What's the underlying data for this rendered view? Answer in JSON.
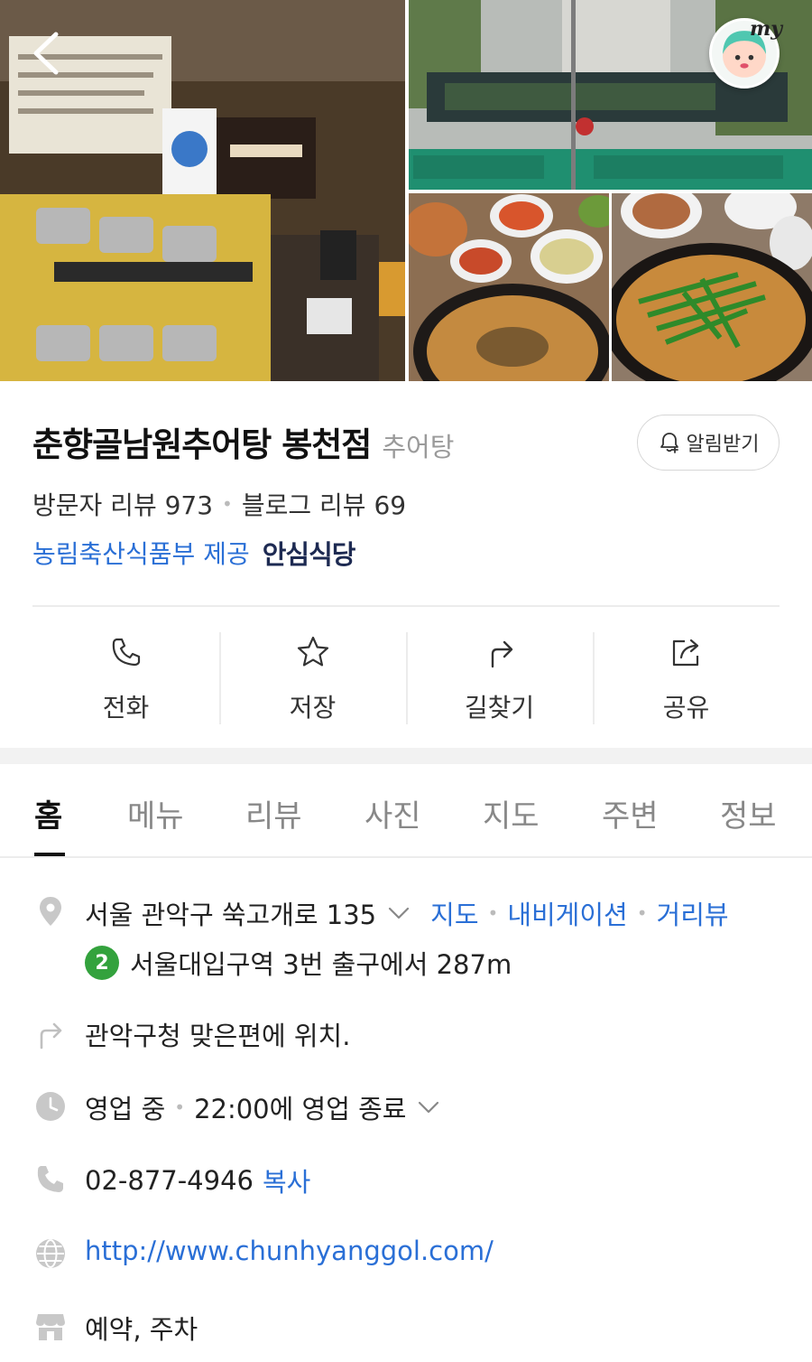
{
  "header": {
    "my_label": "my",
    "icons": {
      "back": "chevron-left-icon",
      "profile": "avatar-icon"
    }
  },
  "place": {
    "name": "춘향골남원추어탕 봉천점",
    "category": "추어탕",
    "alert_label": "알림받기",
    "visitor_reviews": "방문자 리뷰 973",
    "blog_reviews": "블로그 리뷰 69",
    "provider": "농림축산식품부 제공",
    "badge": "안심식당"
  },
  "actions": [
    {
      "label": "전화",
      "icon": "phone-icon"
    },
    {
      "label": "저장",
      "icon": "star-icon"
    },
    {
      "label": "길찾기",
      "icon": "directions-icon"
    },
    {
      "label": "공유",
      "icon": "share-icon"
    }
  ],
  "tabs": [
    {
      "label": "홈"
    },
    {
      "label": "메뉴"
    },
    {
      "label": "리뷰"
    },
    {
      "label": "사진"
    },
    {
      "label": "지도"
    },
    {
      "label": "주변"
    },
    {
      "label": "정보"
    }
  ],
  "info": {
    "address": "서울 관악구 쑥고개로 135",
    "map_link": "지도",
    "nav_link": "내비게이션",
    "street_link": "거리뷰",
    "subway_line": "2",
    "subway_text": "서울대입구역 3번 출구에서 287m",
    "direction_note": "관악구청 맞은편에 위치.",
    "status": "영업 중",
    "hours": "22:00에 영업 종료",
    "phone": "02-877-4946",
    "copy_label": "복사",
    "website": "http://www.chunhyanggol.com/",
    "amenities": "예약, 주차"
  },
  "colors": {
    "link": "#2a6fd6",
    "subway_line2": "#33a23d",
    "badge": "#1d2a52"
  }
}
